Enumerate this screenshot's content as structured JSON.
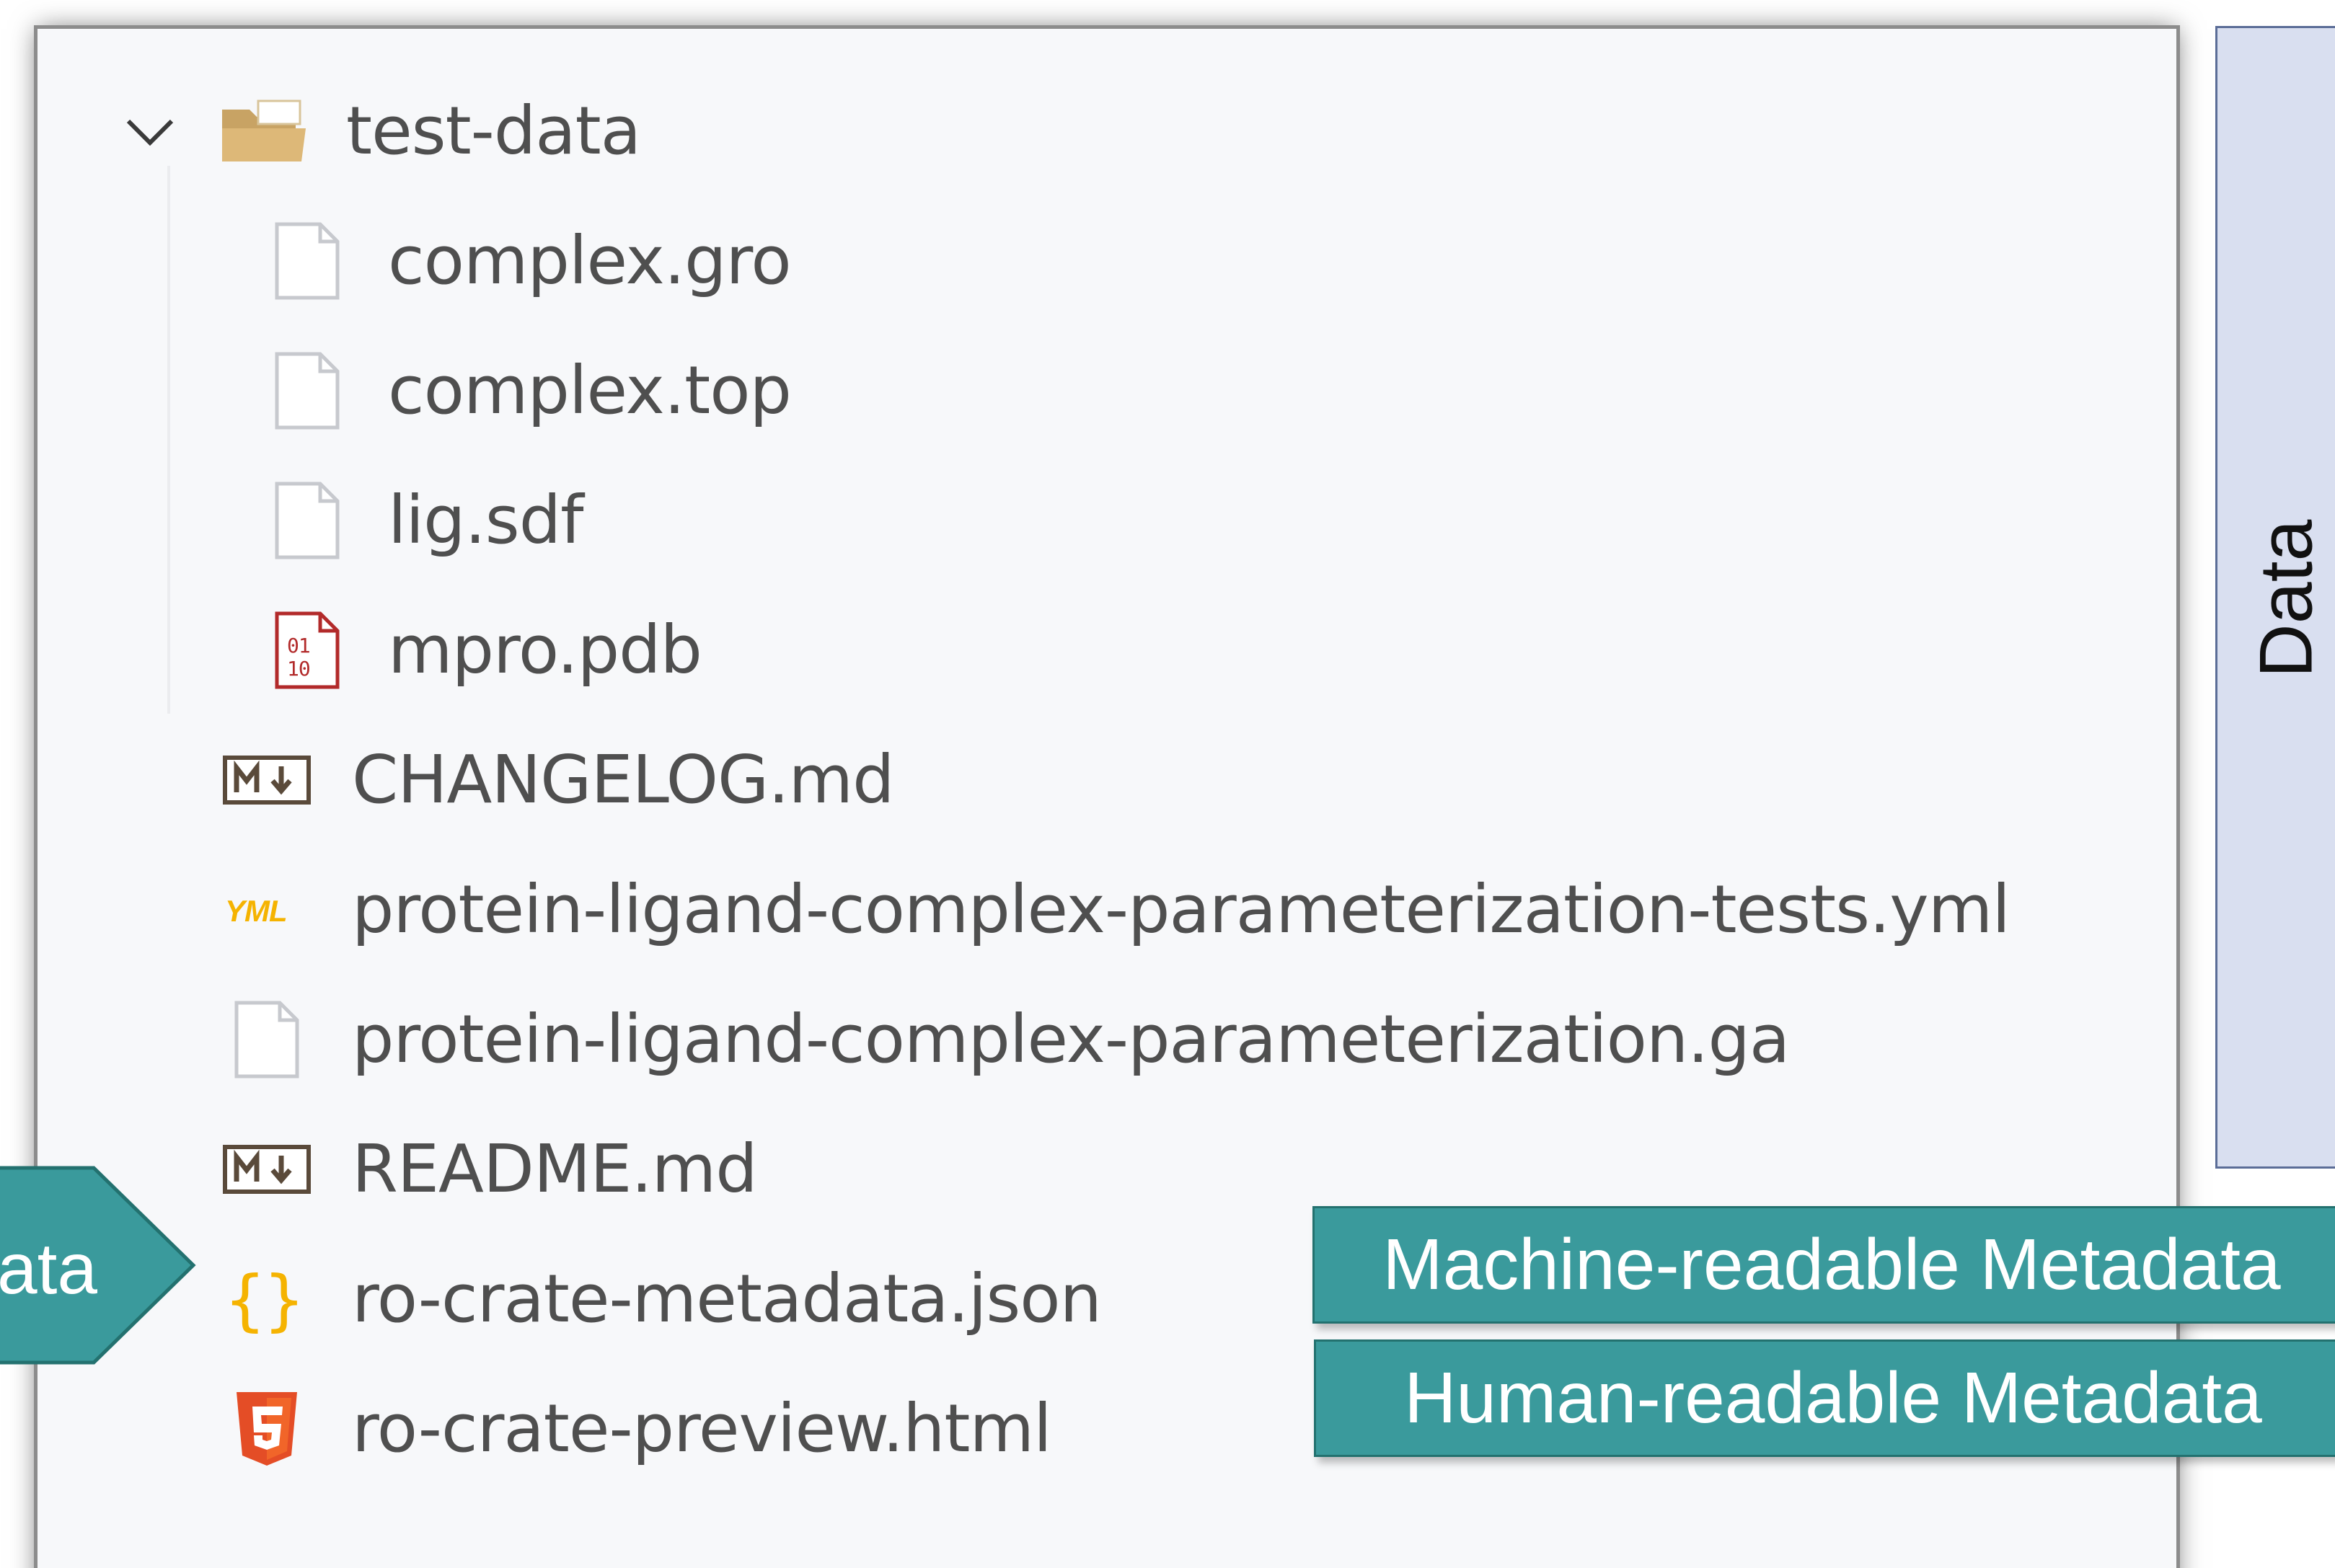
{
  "explorer": {
    "folder": {
      "name": "test-data",
      "expanded": true,
      "icon": "folder-open-icon",
      "children": [
        {
          "name": "complex.gro",
          "icon": "file-icon"
        },
        {
          "name": "complex.top",
          "icon": "file-icon"
        },
        {
          "name": "lig.sdf",
          "icon": "file-icon"
        },
        {
          "name": "mpro.pdb",
          "icon": "binary-file-icon"
        }
      ]
    },
    "files": [
      {
        "name": "CHANGELOG.md",
        "icon": "markdown-icon"
      },
      {
        "name": "protein-ligand-complex-parameterization-tests.yml",
        "icon": "yaml-icon"
      },
      {
        "name": "protein-ligand-complex-parameterization.ga",
        "icon": "file-icon"
      },
      {
        "name": "README.md",
        "icon": "markdown-icon"
      },
      {
        "name": "ro-crate-metadata.json",
        "icon": "json-icon"
      },
      {
        "name": "ro-crate-preview.html",
        "icon": "html5-icon"
      }
    ]
  },
  "annotations": {
    "side_bar_label": "Data",
    "arrow_label": "ata",
    "machine_readable": "Machine-readable Metadata",
    "human_readable": "Human-readable Metadata"
  },
  "colors": {
    "panel_background": "#f7f8fa",
    "callout_teal": "#3a9a9c",
    "data_bar_fill": "#d9dff0",
    "data_bar_border": "#5b6d97",
    "folder_tan": "#d8b678",
    "json_brace": "#f5b301",
    "yaml_accent": "#f5b301",
    "html5_orange": "#e44d26",
    "binary_red": "#b22a2a"
  }
}
